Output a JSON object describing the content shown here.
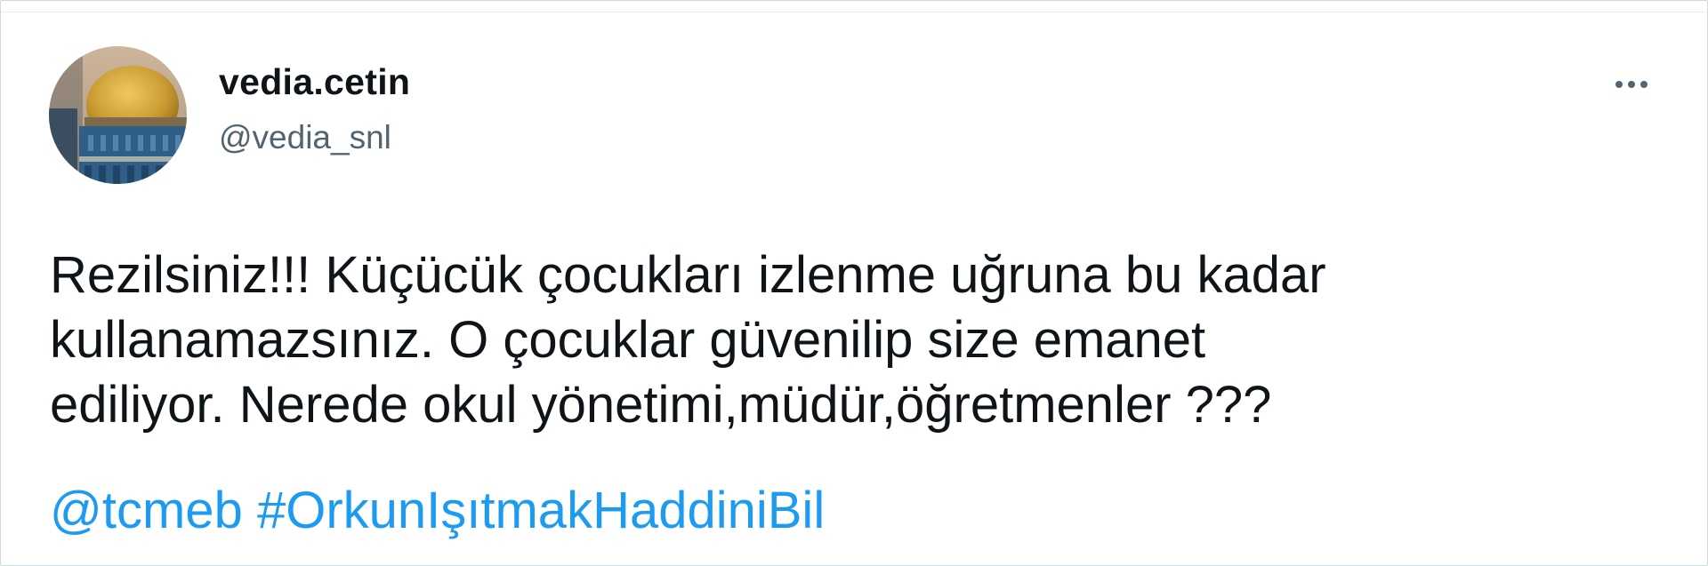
{
  "user": {
    "display_name": "vedia.cetin",
    "handle": "@vedia_snl"
  },
  "tweet": {
    "text": "Rezilsiniz!!! Küçücük çocukları izlenme uğruna bu kadar\nkullanamazsınız. O çocuklar güvenilip size emanet\nediliyor. Nerede okul yönetimi,müdür,öğretmenler ???",
    "mention": "@tcmeb",
    "hashtag": "#OrkunIşıtmakHaddiniBil"
  },
  "icons": {
    "more": "more-horizontal-icon",
    "avatar": "avatar-image"
  },
  "colors": {
    "text_primary": "#0f1419",
    "text_secondary": "#536471",
    "link": "#1d9bf0",
    "border": "#cfd9de"
  }
}
